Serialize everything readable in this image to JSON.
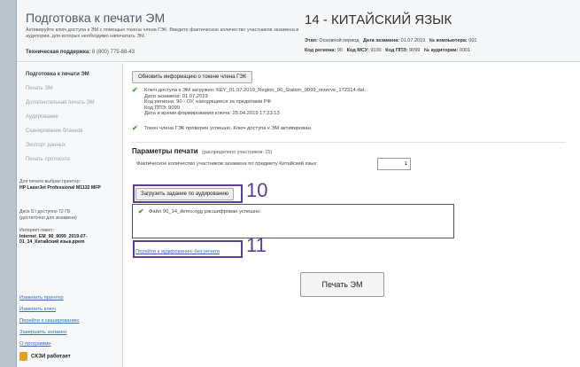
{
  "header": {
    "title": "Подготовка к печати ЭМ",
    "description": "Активируйте ключ доступа к ЭМ с помощью токена члена ГЭК. Введите фактическое количество участников экзамена в аудитории, для которых необходимо напечатать ЭМ.",
    "support_label": "Техническая поддержка:",
    "support_phone": "8 (800) 775-88-43",
    "exam_title": "14 - КИТАЙСКИЙ ЯЗЫК",
    "stage_label": "Этап:",
    "stage_value": "Основной период",
    "date_label": "Дата экзамена:",
    "date_value": "01.07.2019",
    "pc_label": "№ компьютера:",
    "pc_value": "001",
    "region_label": "Код региона:",
    "region_value": "90",
    "msu_label": "Код МСУ:",
    "msu_value": "9100",
    "ppe_label": "Код ППЭ:",
    "ppe_value": "9099",
    "aud_label": "№ аудитории:",
    "aud_value": "0001"
  },
  "sidebar": {
    "items": [
      {
        "label": "Подготовка к печати ЭМ"
      },
      {
        "label": "Печать ЭМ"
      },
      {
        "label": "Дополнительная печать ЭМ"
      },
      {
        "label": "Аудирование"
      },
      {
        "label": "Сканирование бланков"
      },
      {
        "label": "Экспорт данных"
      },
      {
        "label": "Печать протокола"
      }
    ],
    "printer_caption": "Для печати выбран принтер:",
    "printer_name": "HP LaserJet Professional M1132 MFP",
    "disk_line1": "Диск S:\\ доступно 72 ГБ",
    "disk_line2": "(достаточно для экзамена)",
    "package_caption": "Интернет-пакет:",
    "package_name": "Internet_EM_90_9099_2019-07-01_14_Китайский язык.ppem",
    "links": [
      "Изменить принтер",
      "Изменить ключ",
      "Перейти к сканированию",
      "Завершить экзамен",
      "О программе"
    ],
    "skzi": "СКЗИ работает"
  },
  "main": {
    "refresh_button": "Обновить информацию о токене члена ГЭК",
    "key_loaded": "Ключ доступа к ЭМ загружен: KEY_01.07.2019_Region_90_Station_9099_reserve_172314.dat.",
    "key_date": "Дата экзамена: 01.07.2019",
    "key_region": "Код региона: 90 - ОУ, находящиеся за пределами РФ",
    "key_ppe": "Код ППЭ: 9099",
    "key_created": "Дата и время формирования ключа: 25.04.2019 17:23:13",
    "token_ok": "Токен члена ГЭК проверен успешно. Ключ доступа к ЭМ активирован.",
    "params_title": "Параметры печати",
    "params_note": "(распределено участников: 15)",
    "qty_label": "Фактическое количество участников экзамена по предмету Китайский язык:",
    "qty_value": "1",
    "load_audio_button": "Загрузить задание по аудированию",
    "audio_status": "Файл 90_14_demo.ogg расшифрован успешно.",
    "no_audio_link": "Перейти к аудированию без печати",
    "print_button": "Печать ЭМ"
  },
  "annotations": {
    "callout_10": "10",
    "callout_11": "11",
    "highlight_color": "#5b3e99"
  }
}
